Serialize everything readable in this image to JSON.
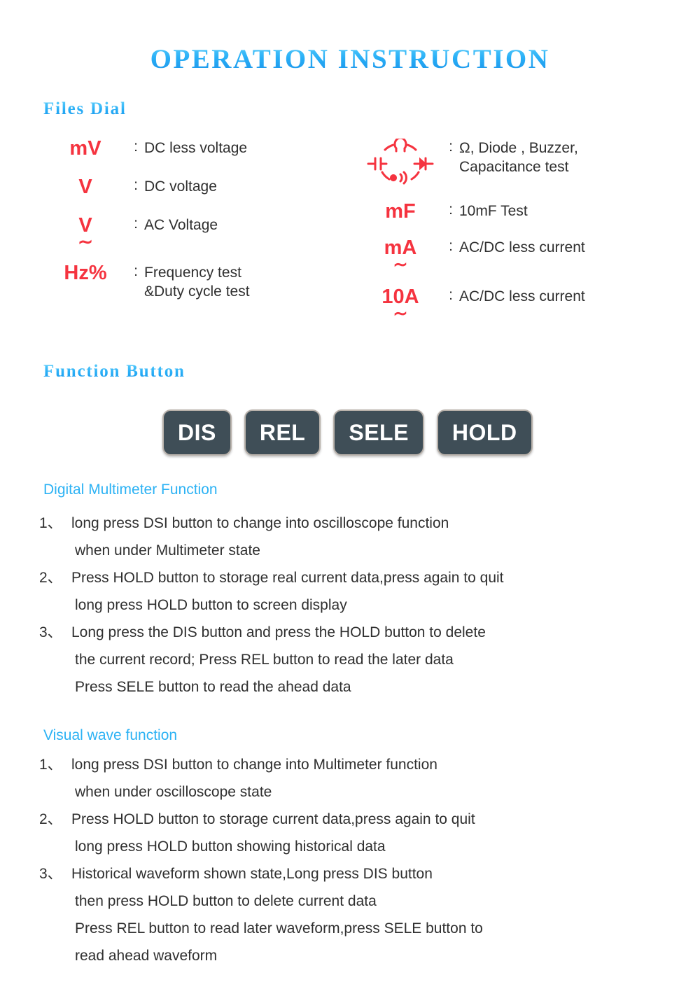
{
  "title": "OPERATION INSTRUCTION",
  "sections": {
    "files_dial_heading": "Files Dial",
    "function_button_heading": "Function Button",
    "dmm_heading": "Digital Multimeter Function",
    "visual_heading": "Visual wave function"
  },
  "colors": {
    "heading_blue": "#2cb2f4",
    "symbol_red": "#f5333f",
    "button_bg": "#3f4e57",
    "button_border": "#b9b2ab",
    "body_text": "#2f2f2f",
    "page_bg": "#ffffff"
  },
  "dial_left": [
    {
      "symbol": "mV",
      "marker": "dc",
      "colon": ":",
      "description": "DC less voltage"
    },
    {
      "symbol": "V",
      "marker": "dc",
      "colon": ":",
      "description": "DC voltage"
    },
    {
      "symbol": "V",
      "marker": "ac",
      "colon": ":",
      "description": "AC Voltage"
    },
    {
      "symbol": "Hz%",
      "marker": "none",
      "colon": ":",
      "description": "Frequency test\n&Duty cycle test"
    }
  ],
  "dial_right": [
    {
      "symbol": "",
      "marker": "dial-icon",
      "colon": ":",
      "description": "Ω, Diode , Buzzer,\nCapacitance test"
    },
    {
      "symbol": "mF",
      "marker": "none",
      "colon": ":",
      "description": "10mF Test"
    },
    {
      "symbol": "mA",
      "marker": "acdc",
      "colon": ":",
      "description": "AC/DC less current"
    },
    {
      "symbol": "10A",
      "marker": "acdc",
      "colon": ":",
      "description": "AC/DC less current"
    }
  ],
  "function_buttons": [
    {
      "label": "DIS"
    },
    {
      "label": "REL"
    },
    {
      "label": "SELE"
    },
    {
      "label": "HOLD"
    }
  ],
  "dmm_items": [
    {
      "num": "1、",
      "lines": [
        "long press DSI button to change into oscilloscope function",
        "when under Multimeter state"
      ]
    },
    {
      "num": "2、",
      "lines": [
        "Press HOLD button to storage real current data,press again to quit",
        "long press HOLD button to screen display"
      ]
    },
    {
      "num": "3、",
      "lines": [
        "Long press the DIS button and press the HOLD button to delete",
        "the current record; Press REL button to read the later data",
        "Press SELE button to read the ahead data"
      ]
    }
  ],
  "visual_items": [
    {
      "num": "1、",
      "lines": [
        "long press DSI button to change into Multimeter function",
        "when under oscilloscope state"
      ]
    },
    {
      "num": "2、",
      "lines": [
        "Press HOLD button to storage current data,press again to quit",
        "long press HOLD button showing historical data"
      ]
    },
    {
      "num": "3、",
      "lines": [
        "Historical waveform shown state,Long press DIS button",
        "then press HOLD button to delete current data",
        "Press REL button to read later waveform,press SELE button to",
        "read ahead waveform"
      ]
    }
  ]
}
